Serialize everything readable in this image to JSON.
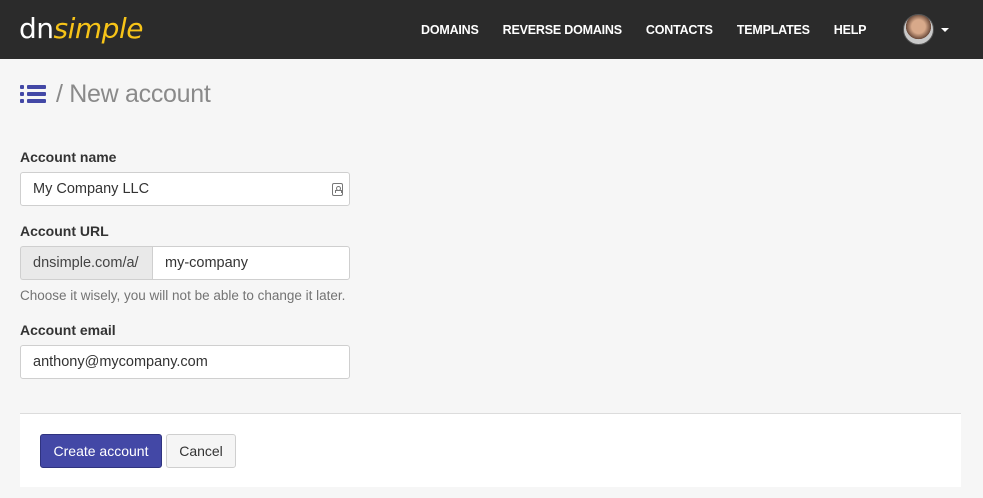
{
  "brand": {
    "logo_dn": "dn",
    "logo_simple": "simple"
  },
  "nav": {
    "items": [
      {
        "label": "DOMAINS"
      },
      {
        "label": "REVERSE DOMAINS"
      },
      {
        "label": "CONTACTS"
      },
      {
        "label": "TEMPLATES"
      },
      {
        "label": "HELP"
      }
    ]
  },
  "header": {
    "title": "/ New account"
  },
  "form": {
    "account_name": {
      "label": "Account name",
      "value": "My Company LLC"
    },
    "account_url": {
      "label": "Account URL",
      "prefix": "dnsimple.com/a/",
      "value": "my-company",
      "help": "Choose it wisely, you will not be able to change it later."
    },
    "account_email": {
      "label": "Account email",
      "value": "anthony@mycompany.com"
    }
  },
  "actions": {
    "create_label": "Create account",
    "cancel_label": "Cancel"
  },
  "colors": {
    "topbar": "#2b2b2b",
    "brand_accent": "#f7c418",
    "primary": "#4348a6",
    "list_icon": "#4348a6"
  },
  "icons": {
    "list": "list-icon",
    "contact": "contact-card-icon",
    "caret": "caret-down-icon"
  }
}
